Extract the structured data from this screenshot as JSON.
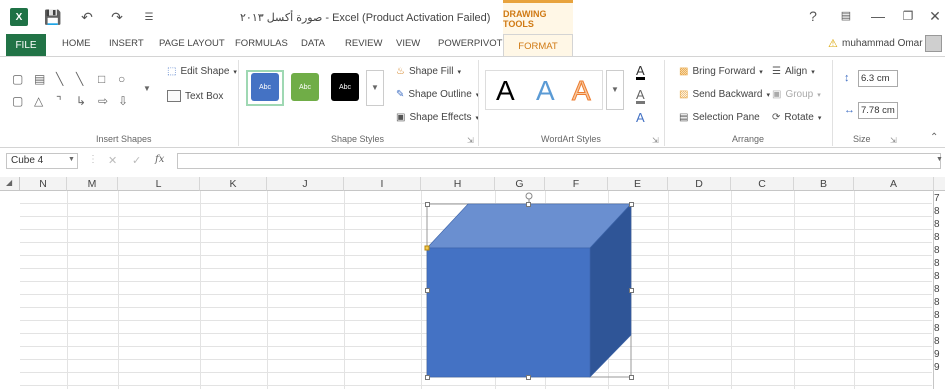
{
  "app": {
    "doc_title": "صورة أكسل ٢٠١٣ - Excel (Product Activation Failed)",
    "context_tab_group": "DRAWING TOOLS",
    "help": "?",
    "user_name": "muhammad Omar"
  },
  "tabs": [
    "FILE",
    "HOME",
    "INSERT",
    "PAGE LAYOUT",
    "FORMULAS",
    "DATA",
    "REVIEW",
    "VIEW",
    "POWERPIVOT",
    "FORMAT"
  ],
  "ribbon": {
    "insert_shapes": {
      "label": "Insert Shapes",
      "edit_shape": "Edit Shape",
      "text_box": "Text Box"
    },
    "shape_styles": {
      "label": "Shape Styles",
      "swatches": [
        {
          "text": "Abc",
          "color": "#4472c4"
        },
        {
          "text": "Abc",
          "color": "#70ad47"
        },
        {
          "text": "Abc",
          "color": "#000000"
        }
      ],
      "fill": "Shape Fill",
      "outline": "Shape Outline",
      "effects": "Shape Effects"
    },
    "wordart": {
      "label": "WordArt Styles",
      "letters": [
        "A",
        "A",
        "A"
      ]
    },
    "arrange": {
      "label": "Arrange",
      "bring_forward": "Bring Forward",
      "send_backward": "Send Backward",
      "selection_pane": "Selection Pane",
      "align": "Align",
      "group": "Group",
      "rotate": "Rotate"
    },
    "size": {
      "label": "Size",
      "height": "6.3 cm",
      "width": "7.78 cm"
    }
  },
  "formula_bar": {
    "name_box": "Cube 4",
    "fx": "fx",
    "value": ""
  },
  "grid": {
    "columns": [
      "N",
      "M",
      "L",
      "K",
      "J",
      "I",
      "H",
      "G",
      "F",
      "E",
      "D",
      "C",
      "B",
      "A"
    ],
    "row_numbers": [
      "7",
      "8",
      "8",
      "8",
      "8",
      "8",
      "8",
      "8",
      "8",
      "8",
      "8",
      "8",
      "9",
      "9"
    ]
  },
  "colors": {
    "excel_green": "#217346",
    "cube_front": "#4472c4",
    "cube_top": "#6a8fd0",
    "cube_side": "#2f5597",
    "accent_orange": "#d07a14"
  }
}
